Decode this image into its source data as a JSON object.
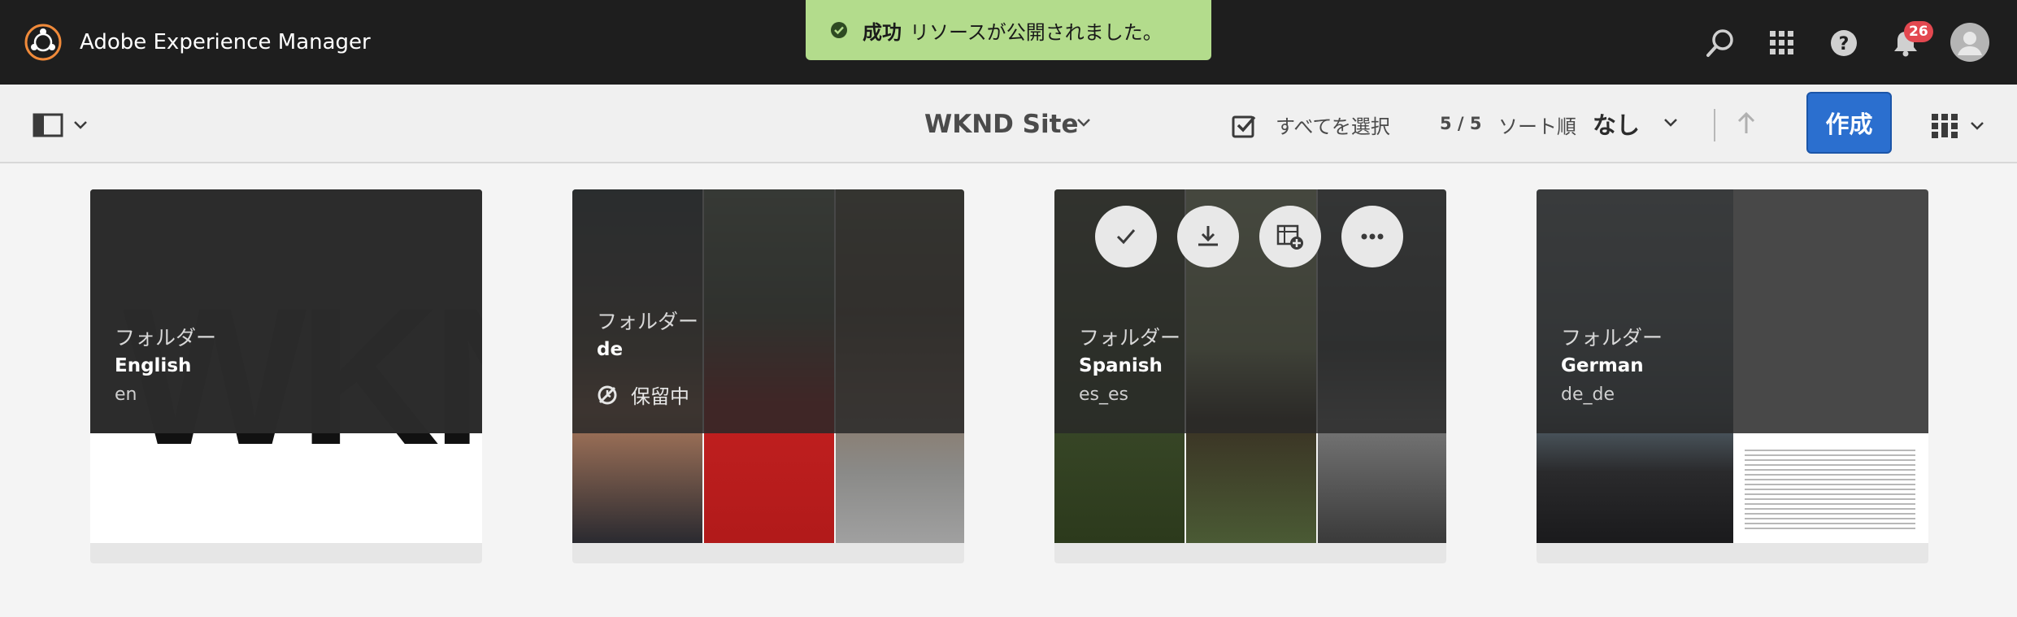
{
  "shell": {
    "app_title": "Adobe Experience Manager",
    "notification_count": "26",
    "icons": [
      "aem-logo-icon",
      "search-icon",
      "app-grid-icon",
      "help-icon",
      "bell-icon",
      "user-avatar-icon"
    ]
  },
  "toast": {
    "status": "成功",
    "message": "リソースが公開されました。",
    "icon": "check-circle-icon",
    "color": "#b3dc8c"
  },
  "actionbar": {
    "site_title": "WKND Site",
    "select_all_label": "すべてを選択",
    "count": "5 / 5",
    "sort_label": "ソート順",
    "sort_value": "なし",
    "create_label": "作成",
    "create_color": "#2b6fcf",
    "icons": [
      "rail-toggle-icon",
      "chevron-down-icon",
      "checkbox-icon",
      "sort-ascending-icon",
      "card-view-icon"
    ]
  },
  "cards": [
    {
      "type": "フォルダー",
      "title": "English",
      "name": "en",
      "thumb_text": "WKND"
    },
    {
      "type": "フォルダー",
      "title": "de",
      "name": "",
      "status": "保留中",
      "status_icon": "pending-icon"
    },
    {
      "type": "フォルダー",
      "title": "Spanish",
      "name": "es_es",
      "quick_actions": [
        "select-check-icon",
        "download-icon",
        "add-to-collection-icon",
        "more-icon"
      ]
    },
    {
      "type": "フォルダー",
      "title": "German",
      "name": "de_de"
    }
  ]
}
